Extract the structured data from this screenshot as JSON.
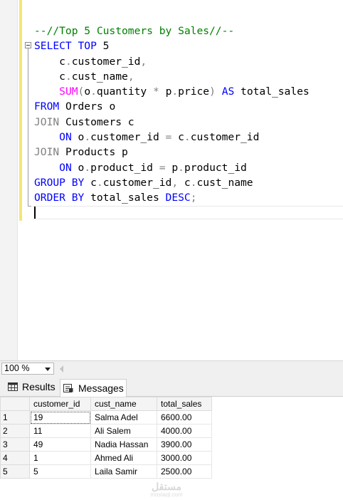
{
  "editor": {
    "lines": [
      [
        {
          "t": "--//Top 5 Customers by Sales//--",
          "c": "cmt"
        }
      ],
      [
        {
          "t": "SELECT",
          "c": "kw"
        },
        {
          "t": " ",
          "c": "id"
        },
        {
          "t": "TOP",
          "c": "kw"
        },
        {
          "t": " 5",
          "c": "id"
        }
      ],
      [
        {
          "t": "    c",
          "c": "id"
        },
        {
          "t": ".",
          "c": "op"
        },
        {
          "t": "customer_id",
          "c": "id"
        },
        {
          "t": ",",
          "c": "op"
        }
      ],
      [
        {
          "t": "    c",
          "c": "id"
        },
        {
          "t": ".",
          "c": "op"
        },
        {
          "t": "cust_name",
          "c": "id"
        },
        {
          "t": ",",
          "c": "op"
        }
      ],
      [
        {
          "t": "    ",
          "c": "id"
        },
        {
          "t": "SUM",
          "c": "fn"
        },
        {
          "t": "(",
          "c": "op"
        },
        {
          "t": "o",
          "c": "id"
        },
        {
          "t": ".",
          "c": "op"
        },
        {
          "t": "quantity ",
          "c": "id"
        },
        {
          "t": "*",
          "c": "op"
        },
        {
          "t": " p",
          "c": "id"
        },
        {
          "t": ".",
          "c": "op"
        },
        {
          "t": "price",
          "c": "id"
        },
        {
          "t": ")",
          "c": "op"
        },
        {
          "t": " ",
          "c": "id"
        },
        {
          "t": "AS",
          "c": "kw"
        },
        {
          "t": " total_sales",
          "c": "id"
        }
      ],
      [
        {
          "t": "FROM",
          "c": "kw"
        },
        {
          "t": " Orders o",
          "c": "id"
        }
      ],
      [
        {
          "t": "JOIN",
          "c": "op"
        },
        {
          "t": " Customers c",
          "c": "id"
        }
      ],
      [
        {
          "t": "    ",
          "c": "id"
        },
        {
          "t": "ON",
          "c": "kw"
        },
        {
          "t": " o",
          "c": "id"
        },
        {
          "t": ".",
          "c": "op"
        },
        {
          "t": "customer_id ",
          "c": "id"
        },
        {
          "t": "=",
          "c": "op"
        },
        {
          "t": " c",
          "c": "id"
        },
        {
          "t": ".",
          "c": "op"
        },
        {
          "t": "customer_id",
          "c": "id"
        }
      ],
      [
        {
          "t": "JOIN",
          "c": "op"
        },
        {
          "t": " Products p",
          "c": "id"
        }
      ],
      [
        {
          "t": "    ",
          "c": "id"
        },
        {
          "t": "ON",
          "c": "kw"
        },
        {
          "t": " o",
          "c": "id"
        },
        {
          "t": ".",
          "c": "op"
        },
        {
          "t": "product_id ",
          "c": "id"
        },
        {
          "t": "=",
          "c": "op"
        },
        {
          "t": " p",
          "c": "id"
        },
        {
          "t": ".",
          "c": "op"
        },
        {
          "t": "product_id",
          "c": "id"
        }
      ],
      [
        {
          "t": "GROUP",
          "c": "kw"
        },
        {
          "t": " ",
          "c": "id"
        },
        {
          "t": "BY",
          "c": "kw"
        },
        {
          "t": " c",
          "c": "id"
        },
        {
          "t": ".",
          "c": "op"
        },
        {
          "t": "customer_id",
          "c": "id"
        },
        {
          "t": ",",
          "c": "op"
        },
        {
          "t": " c",
          "c": "id"
        },
        {
          "t": ".",
          "c": "op"
        },
        {
          "t": "cust_name",
          "c": "id"
        }
      ],
      [
        {
          "t": "ORDER",
          "c": "kw"
        },
        {
          "t": " ",
          "c": "id"
        },
        {
          "t": "BY",
          "c": "kw"
        },
        {
          "t": " total_sales ",
          "c": "id"
        },
        {
          "t": "DESC",
          "c": "kw"
        },
        {
          "t": ";",
          "c": "op"
        }
      ]
    ],
    "colors": {
      "cmt": "#008000",
      "kw": "#0000ff",
      "fn": "#ff00ff",
      "op": "#808080",
      "id": "#000000"
    }
  },
  "zoom": {
    "value": "100 %"
  },
  "tabs": {
    "results_label": "Results",
    "messages_label": "Messages",
    "results_icon": "grid-icon",
    "messages_icon": "messages-icon"
  },
  "results": {
    "columns": [
      "customer_id",
      "cust_name",
      "total_sales"
    ],
    "rows": [
      {
        "n": "1",
        "customer_id": "19",
        "cust_name": "Salma Adel",
        "total_sales": "6600.00"
      },
      {
        "n": "2",
        "customer_id": "11",
        "cust_name": "Ali Salem",
        "total_sales": "4000.00"
      },
      {
        "n": "3",
        "customer_id": "49",
        "cust_name": "Nadia Hassan",
        "total_sales": "3900.00"
      },
      {
        "n": "4",
        "customer_id": "1",
        "cust_name": "Ahmed Ali",
        "total_sales": "3000.00"
      },
      {
        "n": "5",
        "customer_id": "5",
        "cust_name": "Laila Samir",
        "total_sales": "2500.00"
      }
    ]
  },
  "watermark": {
    "logo": "مستقل",
    "text": "mostaql.com"
  }
}
